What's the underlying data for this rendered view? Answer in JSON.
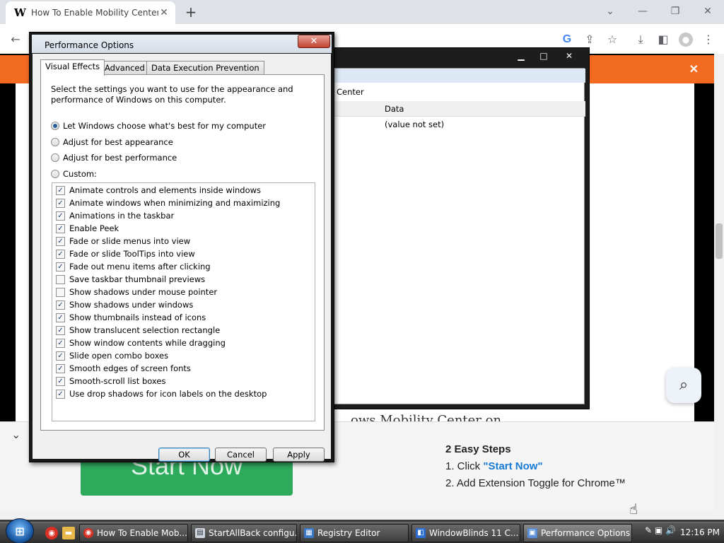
{
  "browser": {
    "tab_title": "How To Enable Mobility Center (",
    "tab_favicon": "W",
    "tab_close": "✕",
    "new_tab": "+",
    "window_controls": {
      "dropdown": "⌄",
      "minimize": "—",
      "restore": "❐",
      "close": "✕"
    },
    "toolbar": {
      "back": "←",
      "google": "G",
      "share": "⇪",
      "star": "☆",
      "download": "⤓",
      "sidepanel": "◧",
      "profile": "●",
      "menu": "⋮"
    }
  },
  "webpage": {
    "banner_close": "✕",
    "heading_peek": "…ows Mobility Center on",
    "search_fab": "⌕",
    "promo": {
      "collapse": "⌄",
      "start_button": "Start Now",
      "steps_title": "2 Easy Steps",
      "step1_prefix": "1. Click ",
      "step1_link": "\"Start Now\"",
      "step2": "2. Add Extension Toggle for Chrome™"
    }
  },
  "registry_window": {
    "controls": {
      "minimize": "▁",
      "maximize": "□",
      "close": "✕"
    },
    "path_fragment": "Center",
    "column_data": "Data",
    "cell_value": "(value not set)"
  },
  "dialog": {
    "title": "Performance Options",
    "close": "✕",
    "tabs": [
      "Visual Effects",
      "Advanced",
      "Data Execution Prevention"
    ],
    "intro": "Select the settings you want to use for the appearance and performance of Windows on this computer.",
    "radios": [
      {
        "label": "Let Windows choose what's best for my computer",
        "selected": true
      },
      {
        "label": "Adjust for best appearance",
        "selected": false
      },
      {
        "label": "Adjust for best performance",
        "selected": false
      },
      {
        "label": "Custom:",
        "selected": false
      }
    ],
    "effects": [
      {
        "label": "Animate controls and elements inside windows",
        "checked": true
      },
      {
        "label": "Animate windows when minimizing and maximizing",
        "checked": true
      },
      {
        "label": "Animations in the taskbar",
        "checked": true
      },
      {
        "label": "Enable Peek",
        "checked": true
      },
      {
        "label": "Fade or slide menus into view",
        "checked": true
      },
      {
        "label": "Fade or slide ToolTips into view",
        "checked": true
      },
      {
        "label": "Fade out menu items after clicking",
        "checked": true
      },
      {
        "label": "Save taskbar thumbnail previews",
        "checked": false
      },
      {
        "label": "Show shadows under mouse pointer",
        "checked": false
      },
      {
        "label": "Show shadows under windows",
        "checked": true
      },
      {
        "label": "Show thumbnails instead of icons",
        "checked": true
      },
      {
        "label": "Show translucent selection rectangle",
        "checked": true
      },
      {
        "label": "Show window contents while dragging",
        "checked": true
      },
      {
        "label": "Slide open combo boxes",
        "checked": true
      },
      {
        "label": "Smooth edges of screen fonts",
        "checked": true
      },
      {
        "label": "Smooth-scroll list boxes",
        "checked": true
      },
      {
        "label": "Use drop shadows for icon labels on the desktop",
        "checked": true
      }
    ],
    "buttons": {
      "ok": "OK",
      "cancel": "Cancel",
      "apply": "Apply"
    }
  },
  "taskbar": {
    "start": "⊞",
    "pinned": [
      "chrome-icon",
      "folder-icon"
    ],
    "buttons": [
      {
        "label": "How To Enable Mob...",
        "icon": "chrome-icon",
        "active": false
      },
      {
        "label": "StartAllBack configu...",
        "icon": "settings-icon",
        "active": false
      },
      {
        "label": "Registry Editor",
        "icon": "registry-icon",
        "active": false
      },
      {
        "label": "WindowBlinds 11 C...",
        "icon": "windowblinds-icon",
        "active": false
      },
      {
        "label": "Performance Options",
        "icon": "performance-icon",
        "active": true
      }
    ],
    "tray_icons": "✎ ▣ 🔊",
    "clock": "12:16 PM"
  },
  "colors": {
    "banner": "#f26b21",
    "start_button": "#2eaa5c",
    "link": "#1a7ad4",
    "dialog_frame": "#181818"
  }
}
